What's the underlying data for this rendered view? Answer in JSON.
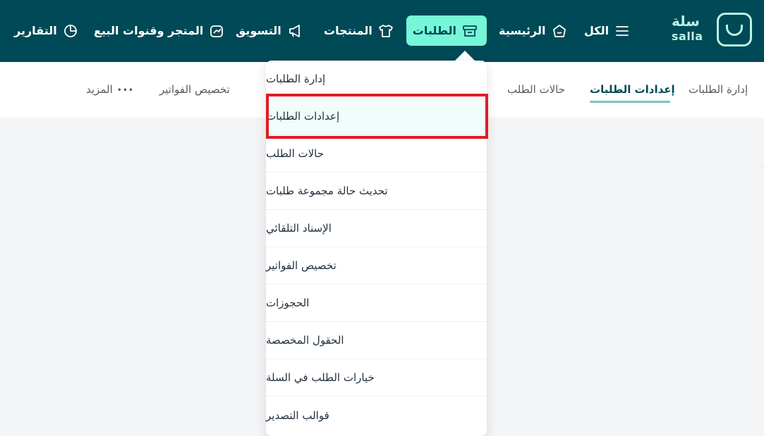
{
  "brand": {
    "name_ar": "سلة",
    "name_en": "salla"
  },
  "nav": {
    "all": "الكل",
    "home": "الرئيسية",
    "orders": "الطلبات",
    "products": "المنتجات",
    "marketing": "التسويق",
    "store": "المتجر وقنوات البيع",
    "reports": "التقارير"
  },
  "subnav": {
    "manage_orders": "إدارة الطلبات",
    "order_settings": "إعدادات الطلبات",
    "order_statuses": "حالات الطلب",
    "invoice_custom": "تخصيص الفواتير",
    "more": "المزيد",
    "more_icon": "•••"
  },
  "dropdown": {
    "items": [
      "إدارة الطلبات",
      "إعدادات الطلبات",
      "حالات الطلب",
      "تحديث حالة مجموعة طلبات",
      "الإسناد التلقائي",
      "تخصيص الفواتير",
      "الحجوزات",
      "الحقول المخصصة",
      "خيارات الطلب في السلة",
      "قوالب التصدير"
    ],
    "highlighted_index": 1
  },
  "colors": {
    "topbar": "#004956",
    "active_tab": "#76f7d8",
    "highlight_border": "#e01c25",
    "brand_mint": "#baf3e6"
  }
}
